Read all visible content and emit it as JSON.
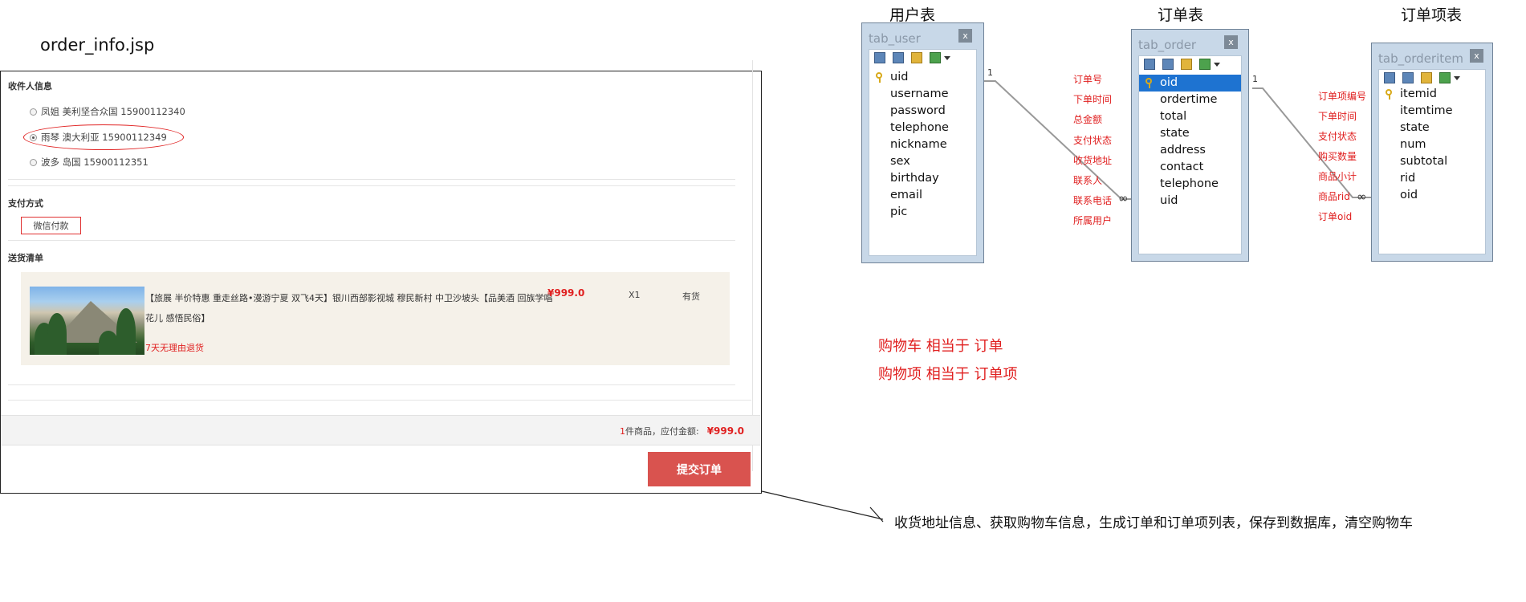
{
  "file_title": "order_info.jsp",
  "order_page": {
    "receiver_section_title": "收件人信息",
    "addresses": [
      {
        "label": "凤姐 美利坚合众国 15900112340",
        "checked": false
      },
      {
        "label": "雨琴 澳大利亚 15900112349",
        "checked": true
      },
      {
        "label": "波多 岛国 15900112351",
        "checked": false
      }
    ],
    "payment_section_title": "支付方式",
    "payment_method": "微信付款",
    "delivery_section_title": "送货清单",
    "item": {
      "name": "【旅展 半价特惠 重走丝路•漫游宁夏 双飞4天】银川西部影视城 穆民新村 中卫沙坡头【品美酒 回族学唱花儿 感悟民俗】",
      "price": "¥999.0",
      "qty": "X1",
      "stock": "有货",
      "return_policy": "7天无理由退货"
    },
    "summary": {
      "count": "1",
      "count_suffix": "件商品，应付金额:",
      "amount": "¥999.0"
    },
    "submit_label": "提交订单"
  },
  "er_diagram": {
    "tables": [
      {
        "caption": "用户表",
        "window_title": "tab_user",
        "close": "x",
        "fields": [
          "uid",
          "username",
          "password",
          "telephone",
          "nickname",
          "sex",
          "birthday",
          "email",
          "pic"
        ],
        "key_field": "uid"
      },
      {
        "caption": "订单表",
        "window_title": "tab_order",
        "close": "x",
        "fields": [
          "oid",
          "ordertime",
          "total",
          "state",
          "address",
          "contact",
          "telephone",
          "uid"
        ],
        "key_field": "oid",
        "selected_field": "oid"
      },
      {
        "caption": "订单项表",
        "window_title": "tab_orderitem",
        "close": "x",
        "fields": [
          "itemid",
          "itemtime",
          "state",
          "num",
          "subtotal",
          "rid",
          "oid"
        ],
        "key_field": "itemid"
      }
    ],
    "order_field_notes": [
      "订单号",
      "下单时间",
      "总金额",
      "支付状态",
      "收货地址",
      "联系人",
      "联系电话",
      "所属用户"
    ],
    "orderitem_field_notes": [
      "订单项编号",
      "下单时间",
      "支付状态",
      "购买数量",
      "商品小计",
      "商品rid",
      "订单oid"
    ],
    "relation_one_label": "1",
    "relation_many_label": "∞",
    "analogy_notes": [
      "购物车  相当于 订单",
      "购物项 相当于  订单项"
    ],
    "bottom_note": "收货地址信息、获取购物车信息，生成订单和订单项列表，保存到数据库，清空购物车"
  },
  "colors": {
    "accent_red": "#e02020",
    "submit_button": "#d9534f",
    "selected_row": "#1e73d1",
    "window_frame": "#c8d8e8"
  },
  "icons": [
    "key-icon",
    "radio-icon",
    "close-icon",
    "toolbar-icons"
  ]
}
